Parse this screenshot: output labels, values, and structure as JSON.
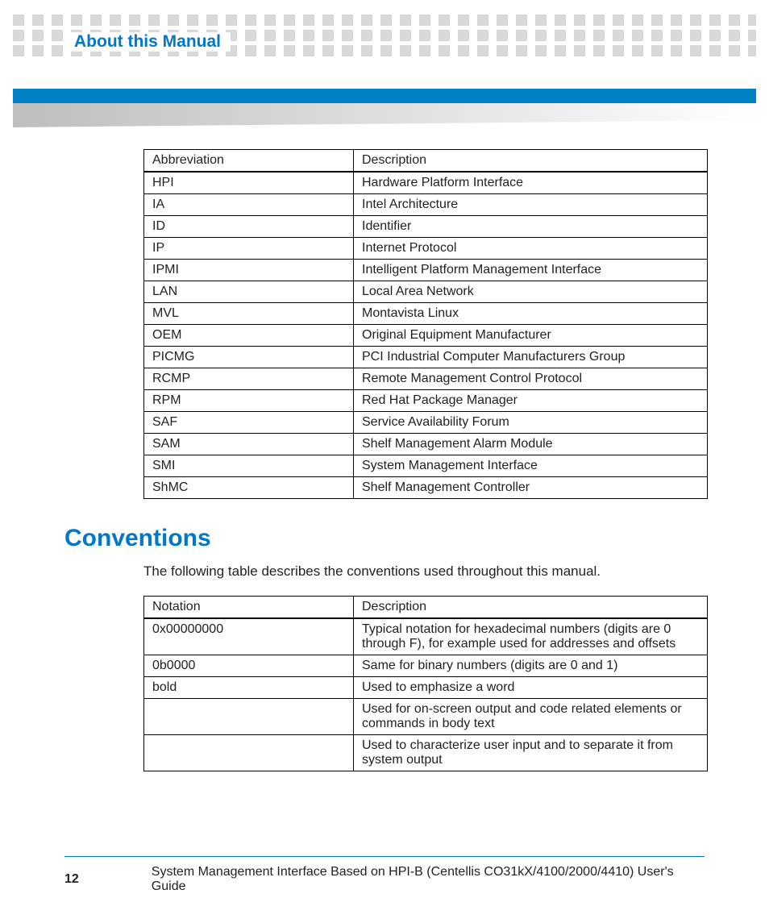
{
  "header": {
    "title": "About this Manual"
  },
  "abbreviations": {
    "col1": "Abbreviation",
    "col2": "Description",
    "rows": [
      {
        "abbr": "HPI",
        "desc": "Hardware Platform Interface"
      },
      {
        "abbr": "IA",
        "desc": "Intel Architecture"
      },
      {
        "abbr": "ID",
        "desc": "Identifier"
      },
      {
        "abbr": "IP",
        "desc": "Internet Protocol"
      },
      {
        "abbr": "IPMI",
        "desc": " Intelligent Platform Management Interface"
      },
      {
        "abbr": "LAN",
        "desc": "Local Area Network"
      },
      {
        "abbr": "MVL",
        "desc": "Montavista Linux"
      },
      {
        "abbr": "OEM",
        "desc": "Original Equipment Manufacturer"
      },
      {
        "abbr": "PICMG",
        "desc": "PCI Industrial Computer Manufacturers Group"
      },
      {
        "abbr": "RCMP",
        "desc": "Remote Management Control Protocol"
      },
      {
        "abbr": "RPM",
        "desc": " Red Hat Package Manager"
      },
      {
        "abbr": "SAF",
        "desc": "Service Availability Forum"
      },
      {
        "abbr": "SAM",
        "desc": "Shelf Management Alarm Module"
      },
      {
        "abbr": "SMI",
        "desc": "System Management Interface"
      },
      {
        "abbr": "ShMC",
        "desc": "Shelf Management Controller"
      }
    ]
  },
  "conventions": {
    "heading": "Conventions",
    "intro": "The following table describes the conventions used throughout this manual.",
    "col1": "Notation",
    "col2": "Description",
    "rows": [
      {
        "notation": "0x00000000",
        "desc": "Typical notation for hexadecimal numbers (digits are 0 through F), for example used for addresses and offsets"
      },
      {
        "notation": "0b0000",
        "desc": "Same for binary numbers (digits are 0 and 1)"
      },
      {
        "notation": "bold",
        "desc": "Used to emphasize a word"
      },
      {
        "notation": "",
        "desc": "Used for on-screen output and code related elements or commands in body text"
      },
      {
        "notation": "",
        "desc": "Used to characterize user input and to separate it from system output"
      }
    ]
  },
  "footer": {
    "page": "12",
    "text": "System Management Interface Based on HPI-B (Centellis CO31kX/4100/2000/4410) User's Guide"
  }
}
